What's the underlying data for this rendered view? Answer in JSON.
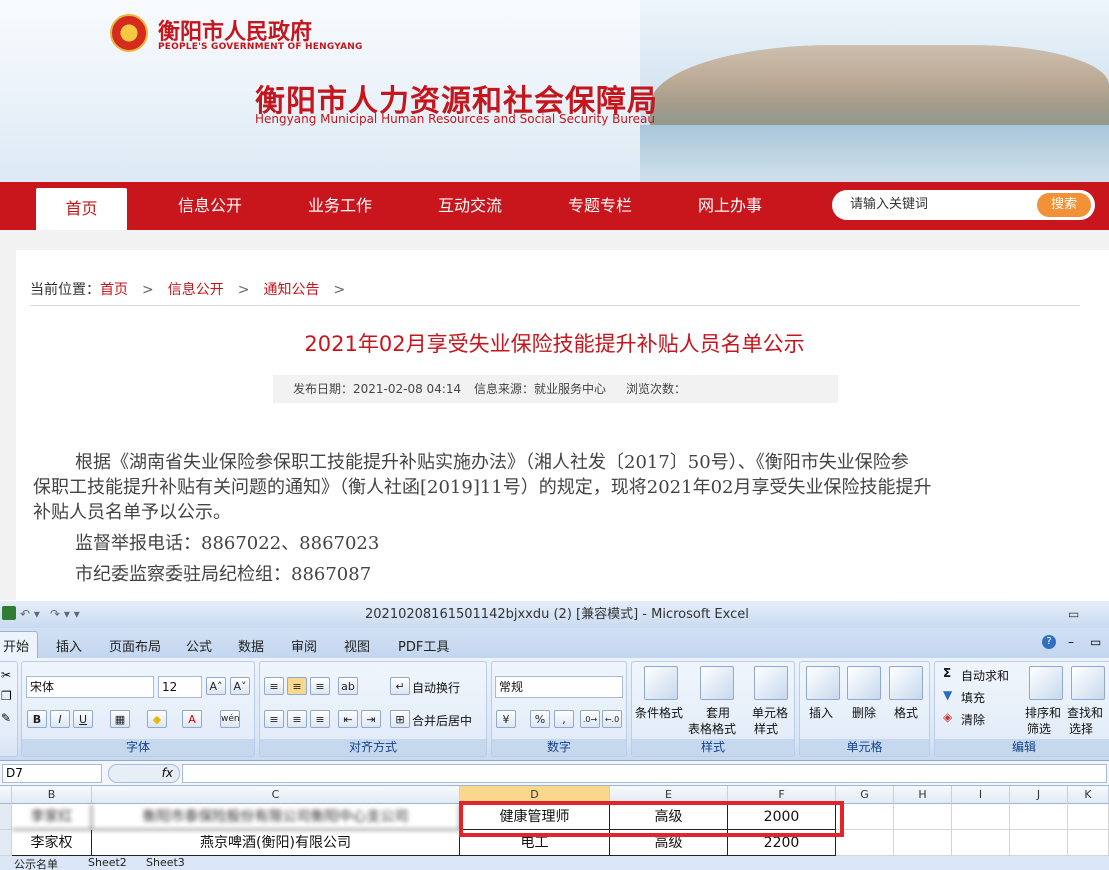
{
  "site": {
    "gov_name_cn": "衡阳市人民政府",
    "gov_name_en": "PEOPLE'S GOVERNMENT OF HENGYANG",
    "bureau_cn": "衡阳市人力资源和社会保障局",
    "bureau_en": "Hengyang Municipal Human Resources and Social Security Bureau"
  },
  "nav": {
    "items": [
      "首页",
      "信息公开",
      "业务工作",
      "互动交流",
      "专题专栏",
      "网上办事"
    ],
    "active": "首页",
    "search_placeholder": "请输入关键词",
    "search_button": "搜索"
  },
  "breadcrumb": {
    "prefix": "当前位置：",
    "items": [
      "首页",
      "信息公开",
      "通知公告"
    ],
    "separator": ">"
  },
  "article": {
    "title": "2021年02月享受失业保险技能提升补贴人员名单公示",
    "publish_date": "发布日期：2021-02-08 04:14",
    "source": "信息来源：就业服务中心",
    "views": "浏览次数：",
    "para1_line1": "根据《湖南省失业保险参保职工技能提升补贴实施办法》（湘人社发〔2017〕50号）、《衡阳市失业保险参",
    "para1_line2": "保职工技能提升补贴有关问题的通知》（衡人社函[2019]11号）的规定，现将2021年02月享受失业保险技能提升",
    "para1_line3": "补贴人员名单予以公示。",
    "phone": "监督举报电话：8867022、8867023",
    "discipline": "市纪委监察委驻局纪检组：8867087"
  },
  "excel": {
    "window_title": "20210208161501142bjxxdu (2)  [兼容模式] - Microsoft Excel",
    "tabs": [
      "开始",
      "插入",
      "页面布局",
      "公式",
      "数据",
      "审阅",
      "视图",
      "PDF工具"
    ],
    "font_name": "宋体",
    "font_size": "12",
    "number_format": "常规",
    "buttons": {
      "wrap": "自动换行",
      "merge": "合并后居中",
      "cond_format": "条件格式",
      "table_format_1": "套用",
      "table_format_2": "表格格式",
      "cell_style_1": "单元格",
      "cell_style_2": "样式",
      "insert": "插入",
      "delete": "删除",
      "format": "格式",
      "autosum": "自动求和",
      "fill": "填充",
      "clear": "清除",
      "sort_1": "排序和",
      "sort_2": "筛选",
      "find_1": "查找和",
      "find_2": "选择",
      "percent": "%",
      "comma": ","
    },
    "groups": [
      "字体",
      "对齐方式",
      "数字",
      "样式",
      "单元格",
      "编辑"
    ],
    "name_box": "D7",
    "fx": "fx",
    "columns": [
      "B",
      "C",
      "D",
      "E",
      "F",
      "G",
      "H",
      "I",
      "J",
      "K"
    ],
    "rows": [
      {
        "name": "李家红",
        "company": "衡阳市泰保险股份有限公司衡阳中心支公司",
        "job": "健康管理师",
        "level": "高级",
        "amount": "2000"
      },
      {
        "name": "李家权",
        "company": "燕京啤酒(衡阳)有限公司",
        "job": "电工",
        "level": "高级",
        "amount": "2200"
      }
    ],
    "sheets": [
      "公示名单",
      "Sheet2",
      "Sheet3"
    ]
  }
}
